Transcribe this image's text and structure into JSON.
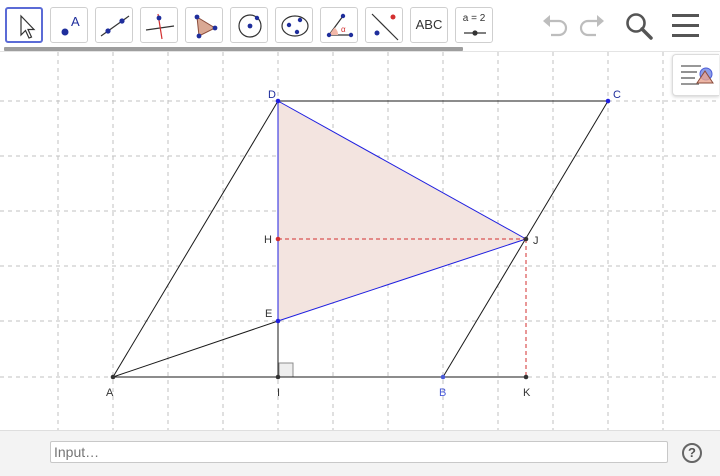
{
  "toolbar": {
    "tools": [
      {
        "name": "move-tool",
        "icon": "cursor-arrow-icon"
      },
      {
        "name": "point-tool",
        "icon": "point-a-icon"
      },
      {
        "name": "line-tool",
        "icon": "line-through-points-icon"
      },
      {
        "name": "perpendicular-line-tool",
        "icon": "perpendicular-icon"
      },
      {
        "name": "polygon-tool",
        "icon": "polygon-icon"
      },
      {
        "name": "circle-tool",
        "icon": "circle-center-point-icon"
      },
      {
        "name": "conic-tool",
        "icon": "ellipse-icon"
      },
      {
        "name": "angle-tool",
        "icon": "angle-icon"
      },
      {
        "name": "reflect-tool",
        "icon": "reflect-icon"
      },
      {
        "name": "text-tool",
        "icon": "text-icon"
      },
      {
        "name": "slider-tool",
        "icon": "slider-icon"
      }
    ],
    "text_tool_label": "ABC",
    "slider_tool_label": "a = 2",
    "undo": "undo-icon",
    "redo": "redo-icon",
    "search": "search-icon",
    "menu": "hamburger-menu-icon"
  },
  "graphics": {
    "points": {
      "A": "A",
      "B": "B",
      "C": "C",
      "D": "D",
      "E": "E",
      "H": "H",
      "I": "I",
      "J": "J",
      "K": "K"
    },
    "style_bar_icon": "style-bar-toggle-icon",
    "colors": {
      "accent": "#5b6bd6",
      "segment_blue": "#1f1fe0",
      "dashed_red": "#d32f2f",
      "triangle_fill": "#f3e4e0",
      "point_b": "#4a5bd8"
    }
  },
  "input_bar": {
    "placeholder": "Input…",
    "help": "?"
  }
}
